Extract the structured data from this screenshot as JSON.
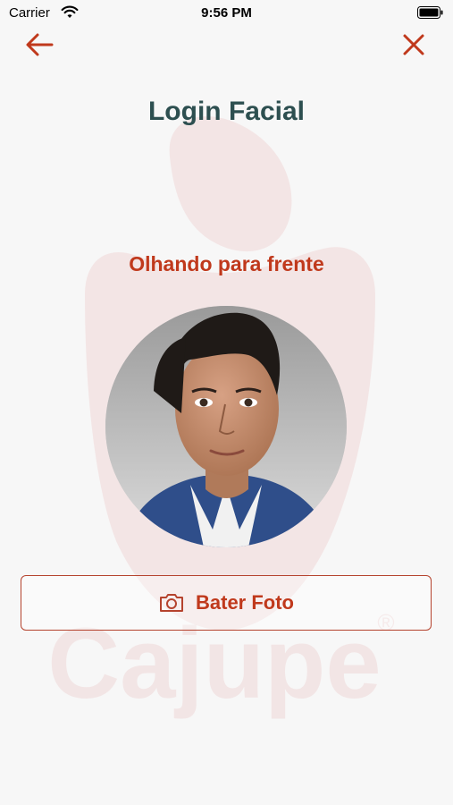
{
  "status_bar": {
    "carrier": "Carrier",
    "time": "9:56 PM"
  },
  "nav": {
    "back_icon": "arrow-left-icon",
    "close_icon": "close-icon"
  },
  "page": {
    "title": "Login Facial",
    "instruction": "Olhando para frente"
  },
  "photo": {
    "subject": "face-photo"
  },
  "capture": {
    "label": "Bater Foto",
    "icon": "camera-icon"
  },
  "watermark": {
    "brand": "Cajupe",
    "mark": "®"
  },
  "colors": {
    "accent": "#c0391c",
    "title": "#2d4f50",
    "background": "#f7f7f7"
  }
}
